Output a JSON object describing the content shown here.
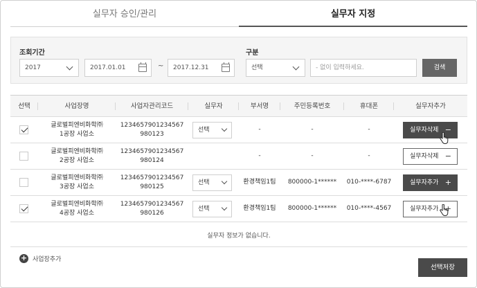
{
  "tabs": [
    {
      "label": "실무자 승인/관리",
      "active": false
    },
    {
      "label": "실무자 지정",
      "active": true
    }
  ],
  "filter": {
    "period_label": "조회기간",
    "year_value": "2017",
    "date_from": "2017.01.01",
    "date_separator": "~",
    "date_to": "2017.12.31",
    "category_label": "구분",
    "category_value": "선택",
    "keyword_placeholder": "- 없이 입력하세요.",
    "search_label": "검색"
  },
  "table": {
    "headers": [
      "선택",
      "사업장명",
      "사업자관리코드",
      "실무자",
      "부서명",
      "주민등록번호",
      "휴대폰",
      "실무자추가"
    ],
    "rows": [
      {
        "checked": true,
        "site_line1": "글로벌피엔비화학㈜",
        "site_line2": "1공장 사업소",
        "code_line1": "1234657901234567",
        "code_line2": "980123",
        "worker": "선택",
        "dept": "-",
        "rrn": "-",
        "phone": "-",
        "action": "실무자삭제",
        "action_sign": "−",
        "action_style": "dark"
      },
      {
        "checked": false,
        "site_line1": "글로벌피엔비화학㈜",
        "site_line2": "2공장 사업소",
        "code_line1": "1234657901234567",
        "code_line2": "980124",
        "worker": "선택",
        "dept": "-",
        "rrn": "-",
        "phone": "-",
        "action": "실무자삭제",
        "action_sign": "−",
        "action_style": "light"
      },
      {
        "checked": false,
        "site_line1": "글로벌피엔비화학㈜",
        "site_line2": "3공장 사업소",
        "code_line1": "1234657901234567",
        "code_line2": "980125",
        "worker": "선택",
        "dept": "환경책임1팀",
        "rrn": "800000-1******",
        "phone": "010-****-6787",
        "action": "실무자추가",
        "action_sign": "+",
        "action_style": "dark"
      },
      {
        "checked": true,
        "site_line1": "글로벌피엔비화학㈜",
        "site_line2": "4공장 사업소",
        "code_line1": "1234657901234567",
        "code_line2": "980126",
        "worker": "선택",
        "dept": "환경책임1팀",
        "rrn": "800000-1******",
        "phone": "010-****-4567",
        "action": "실무자추가",
        "action_sign": "+",
        "action_style": "light"
      }
    ],
    "empty_message": "실무자 정보가 없습니다."
  },
  "footer": {
    "add_site_label": "사업장추가",
    "save_label": "선택저장"
  },
  "icons": {
    "calendar": "calendar-icon",
    "chevron": "chevron-down-icon",
    "plus": "plus-circle-icon",
    "cursor": "hand-cursor-icon"
  }
}
